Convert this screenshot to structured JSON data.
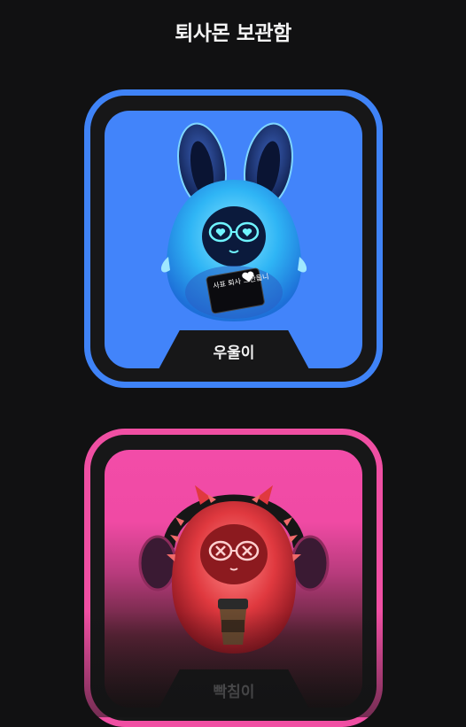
{
  "header": {
    "title": "퇴사몬 보관함"
  },
  "cards": [
    {
      "name": "우울이",
      "icon": "blue-bunny-character-icon",
      "accent": "#3f83f7",
      "sign_text": "사표 퇴사 그만둡니"
    },
    {
      "name": "빡침이",
      "icon": "red-devil-headphones-character-icon",
      "accent": "#f04fa3"
    }
  ]
}
